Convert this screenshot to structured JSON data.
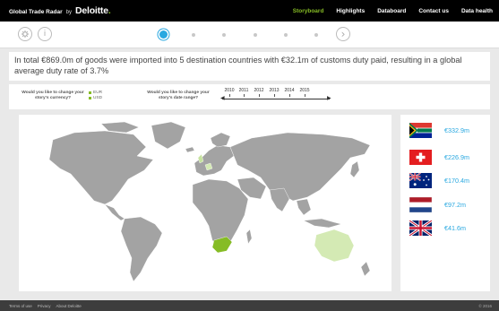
{
  "brand": {
    "app_name": "Global Trade Radar",
    "by": "by",
    "company": "Deloitte",
    "dot": "."
  },
  "nav": {
    "items": [
      {
        "label": "Storyboard",
        "active": true
      },
      {
        "label": "Highlights",
        "active": false
      },
      {
        "label": "Databoard",
        "active": false
      },
      {
        "label": "Contact us",
        "active": false
      },
      {
        "label": "Data health",
        "active": false
      }
    ]
  },
  "stepper": {
    "prev_icon": "gear-settings-icon",
    "info_icon": "info-icon",
    "next_icon": "chevron-right-circle-icon",
    "info_symbol": "i",
    "next_symbol": "›",
    "steps_total": 6,
    "active_step": 1
  },
  "summary": {
    "text": "In total €869.0m of goods were imported into 5 destination countries with €32.1m of customs duty paid, resulting in a global average duty rate of 3.7%"
  },
  "controls": {
    "currency_question": "Would you like to change your story's currency?",
    "currency_options": [
      {
        "label": "EUR",
        "selected": true
      },
      {
        "label": "USD",
        "selected": false
      }
    ],
    "date_question": "Would you like to change your story's date range?",
    "years": [
      "2010",
      "2011",
      "2012",
      "2013",
      "2014",
      "2015"
    ],
    "left_arrow": "◀",
    "right_arrow": "▶"
  },
  "map": {
    "land_color": "#a3a3a3",
    "highlight_color": "#86bc25",
    "light_highlight_color": "#d4eab4"
  },
  "destinations": [
    {
      "country": "South Africa",
      "value": "€332.9m",
      "flag_icon": "south-africa-flag-icon"
    },
    {
      "country": "Switzerland",
      "value": "€226.9m",
      "flag_icon": "switzerland-flag-icon"
    },
    {
      "country": "Australia",
      "value": "€170.4m",
      "flag_icon": "australia-flag-icon"
    },
    {
      "country": "Netherlands",
      "value": "€97.2m",
      "flag_icon": "netherlands-flag-icon"
    },
    {
      "country": "United Kingdom",
      "value": "€41.6m",
      "flag_icon": "uk-flag-icon"
    }
  ],
  "footer": {
    "links": [
      "Terms of use",
      "Privacy",
      "About Deloitte"
    ],
    "copyright": "© 2016"
  },
  "colors": {
    "accent": "#86bc25",
    "link_blue": "#29a8e0",
    "topbar": "#000000"
  }
}
